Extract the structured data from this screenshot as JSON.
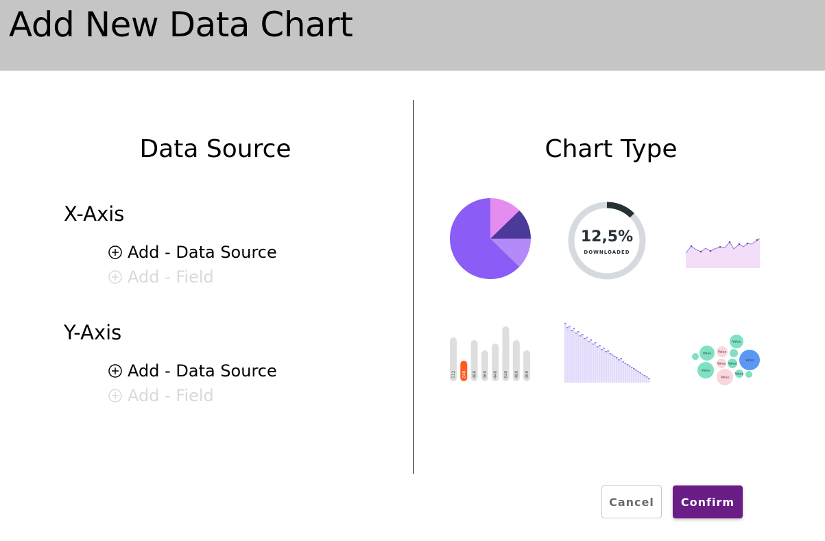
{
  "header": {
    "title": "Add New Data Chart"
  },
  "data_source": {
    "title": "Data Source",
    "x_axis": {
      "label": "X-Axis",
      "add_source_label": "Add - Data Source",
      "add_field_label": "Add - Field"
    },
    "y_axis": {
      "label": "Y-Axis",
      "add_source_label": "Add - Data Source",
      "add_field_label": "Add - Field"
    }
  },
  "chart_type": {
    "title": "Chart Type",
    "options": [
      {
        "name": "pie",
        "icon": "pie-chart-icon"
      },
      {
        "name": "donut",
        "icon": "donut-chart-icon",
        "value_text": "12,5%",
        "caption": "DOWNLOADED",
        "fraction": 0.125
      },
      {
        "name": "area",
        "icon": "area-chart-icon"
      },
      {
        "name": "bar",
        "icon": "bar-chart-icon",
        "bar_labels": [
          "512",
          "240",
          "480",
          "360",
          "440",
          "640",
          "480",
          "360"
        ]
      },
      {
        "name": "histogram",
        "icon": "histogram-chart-icon"
      },
      {
        "name": "bubble",
        "icon": "bubble-chart-icon",
        "bubble_label": "Value"
      }
    ]
  },
  "colors": {
    "header_bg": "#c5c5c5",
    "confirm_bg": "#6a1d86",
    "pie_main": "#8b5cf6",
    "pie_accent": "#e48cf0",
    "pie_dark": "#4c3a9a",
    "donut_track": "#d6dade",
    "donut_fill": "#263238",
    "bar_highlight": "#ff5b1f",
    "bubble_teal": "#7fe0c4",
    "bubble_blue": "#5b97f5",
    "bubble_pink": "#f9d7dc"
  },
  "footer": {
    "cancel_label": "Cancel",
    "confirm_label": "Confirm"
  }
}
